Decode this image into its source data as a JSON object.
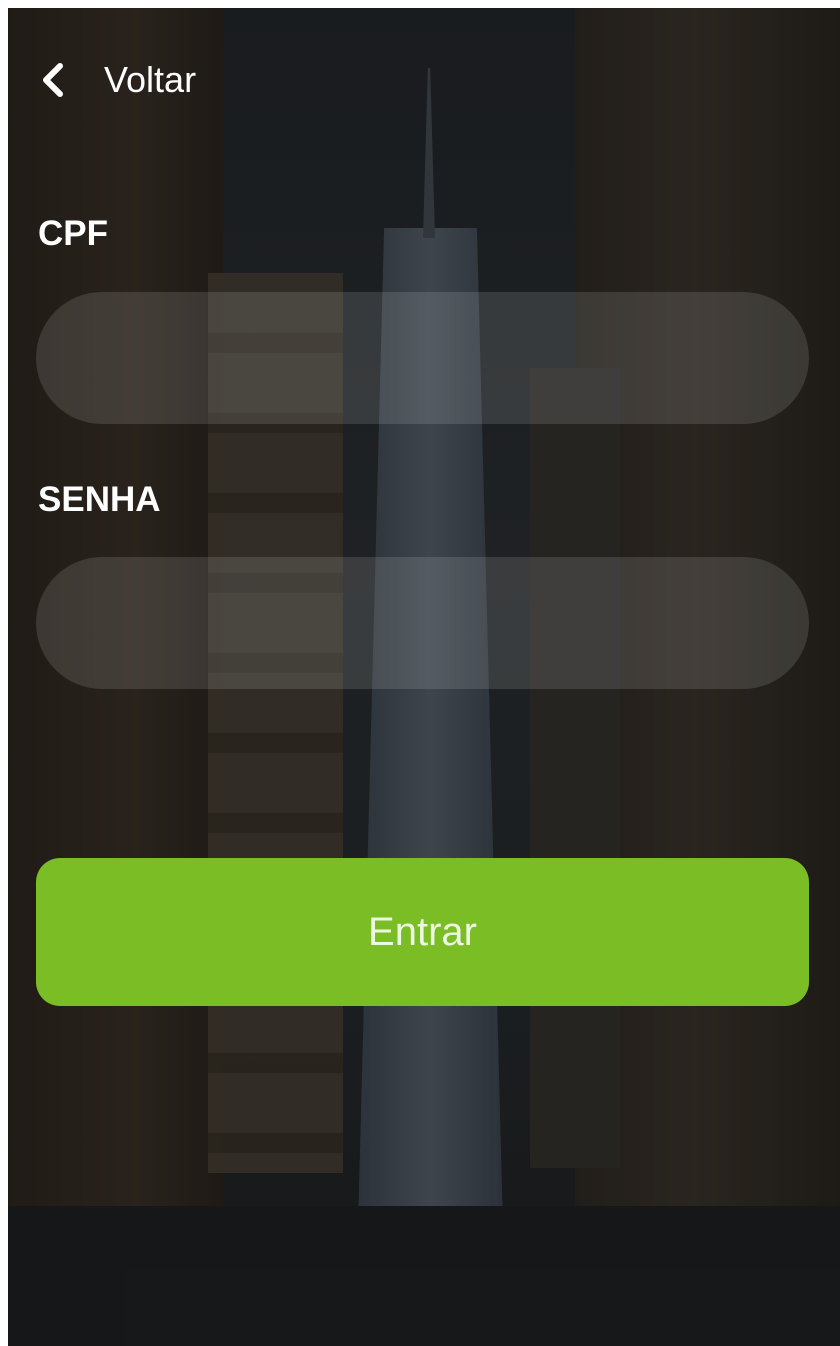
{
  "header": {
    "back_label": "Voltar",
    "back_icon": "chevron-left-icon"
  },
  "form": {
    "cpf": {
      "label": "CPF",
      "value": "",
      "placeholder": ""
    },
    "senha": {
      "label": "SENHA",
      "value": "",
      "placeholder": ""
    },
    "submit_label": "Entrar"
  },
  "colors": {
    "accent": "#7bbd25",
    "field_bg": "rgba(255,255,255,0.12)",
    "text": "#ffffff"
  }
}
